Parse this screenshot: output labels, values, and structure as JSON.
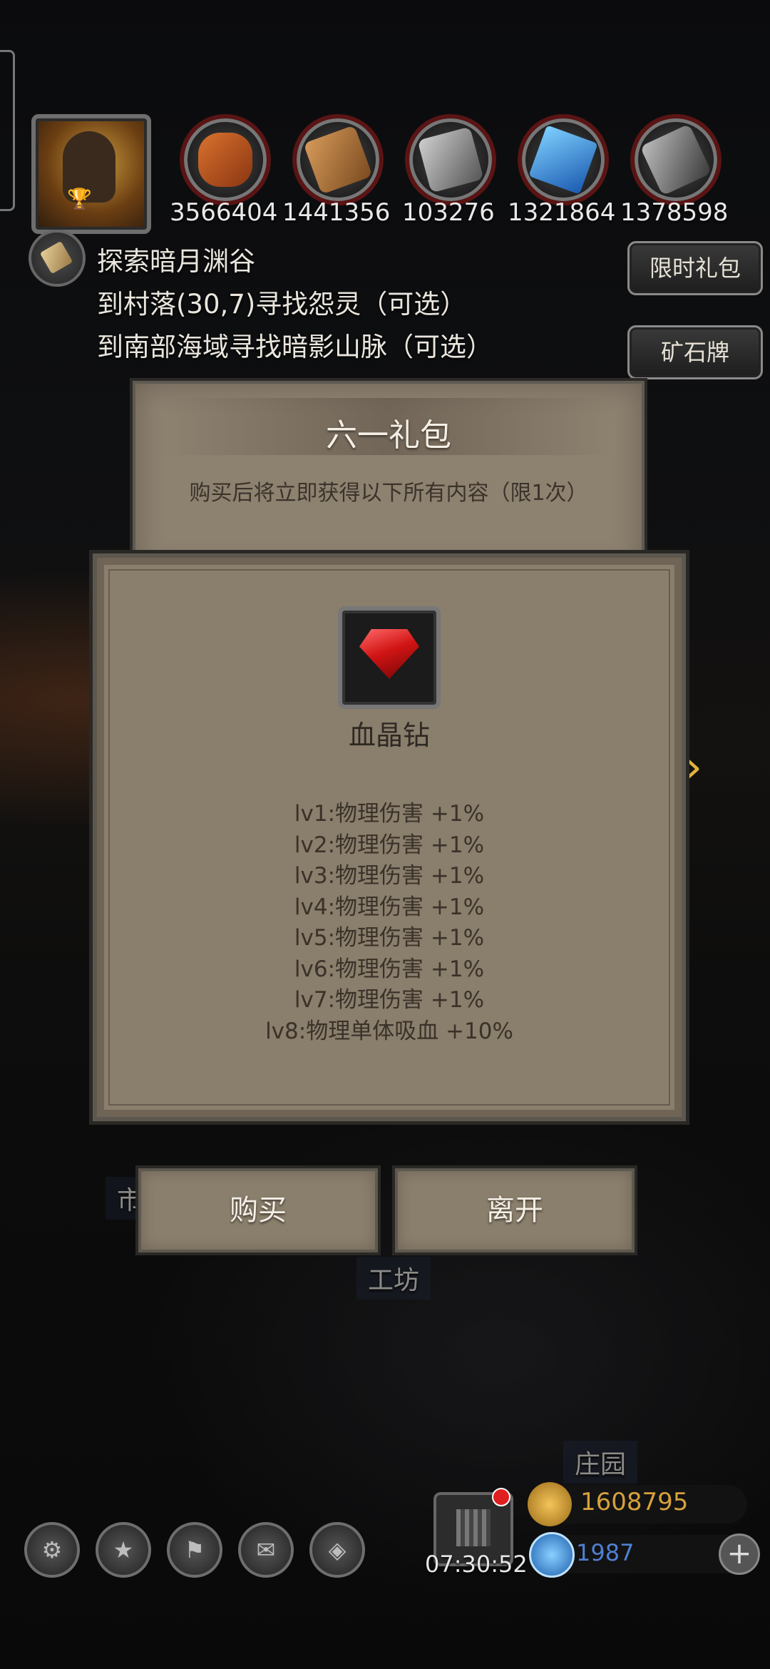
{
  "resources": [
    {
      "name": "meat-icon",
      "value": "3566404"
    },
    {
      "name": "wood-icon",
      "value": "1441356"
    },
    {
      "name": "iron-icon",
      "value": "103276"
    },
    {
      "name": "crystal-icon",
      "value": "1321864"
    },
    {
      "name": "ore-icon",
      "value": "1378598"
    }
  ],
  "quests": {
    "title": "探索暗月渊谷",
    "line1": "到村落(30,7)寻找怨灵（可选）",
    "line2": "到南部海域寻找暗影山脉（可选）"
  },
  "side_buttons": {
    "limited_gift": "限时礼包",
    "ore_plate": "矿石牌"
  },
  "package": {
    "title": "六一礼包",
    "subtitle": "购买后将立即获得以下所有内容（限1次）"
  },
  "item": {
    "name": "血晶钻",
    "icon": "red-gem-icon",
    "stats": [
      "lv1:物理伤害 +1%",
      "lv2:物理伤害 +1%",
      "lv3:物理伤害 +1%",
      "lv4:物理伤害 +1%",
      "lv5:物理伤害 +1%",
      "lv6:物理伤害 +1%",
      "lv7:物理伤害 +1%",
      "lv8:物理单体吸血 +10%"
    ]
  },
  "buttons": {
    "buy": "购买",
    "leave": "离开"
  },
  "map_labels": {
    "market": "市",
    "workshop": "工坊",
    "manor": "庄园"
  },
  "bottom": {
    "timer": "07:30:52",
    "gold": "1608795",
    "gems": "1987",
    "plus": "+"
  },
  "colors": {
    "panel": "#8a7e6c",
    "gold_text": "#d6a13b",
    "gem_text": "#4f7fd0",
    "arrow": "#e2b33a"
  }
}
